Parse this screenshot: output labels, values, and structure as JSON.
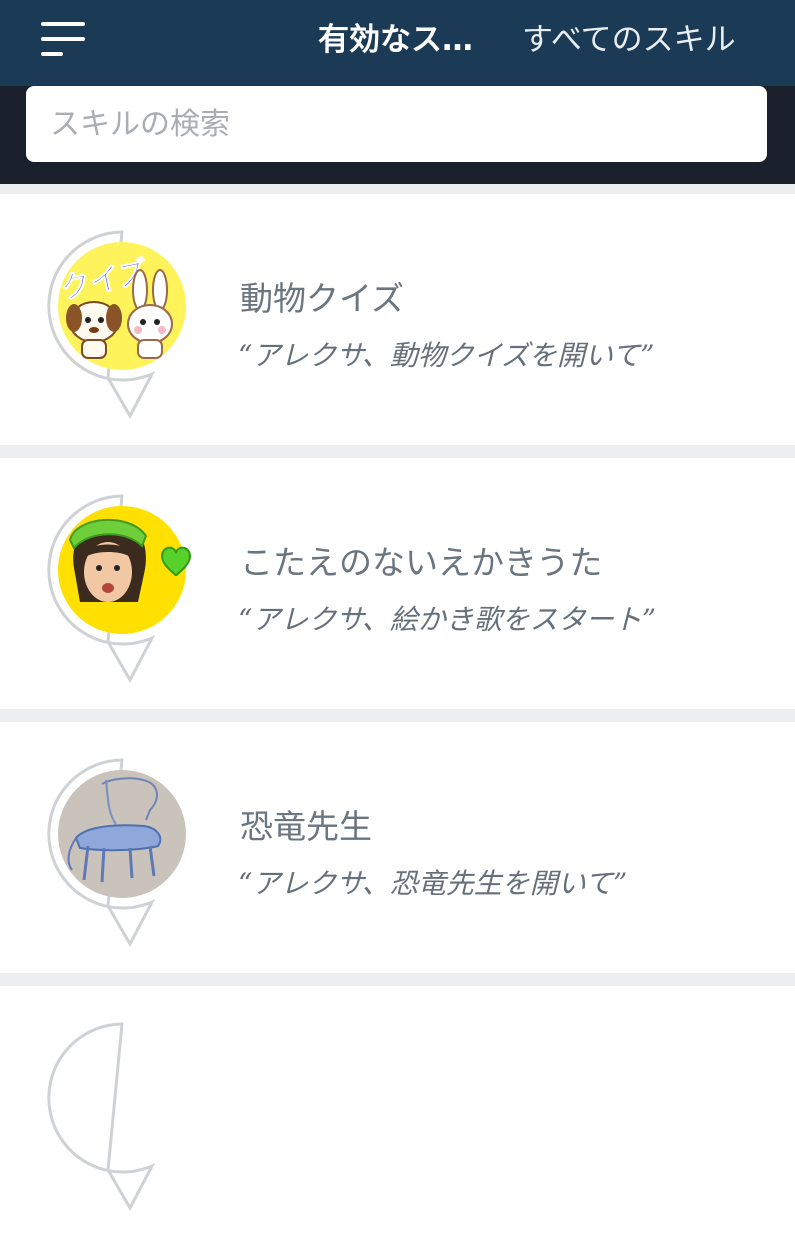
{
  "header": {
    "menu_icon": "hamburger-menu-icon",
    "tabs": [
      {
        "label": "有効なス…",
        "active": true
      },
      {
        "label": "すべてのスキル",
        "active": false
      }
    ],
    "bg_color": "#1b3a55"
  },
  "search": {
    "placeholder": "スキルの検索",
    "value": ""
  },
  "skills": [
    {
      "name": "動物クイズ",
      "phrase": "“アレクサ、動物クイズを開いて”",
      "icon": "animal-quiz-icon",
      "icon_text": "クイズ"
    },
    {
      "name": "こたえのないえかきうた",
      "phrase": "“アレクサ、絵かき歌をスタート”",
      "icon": "girl-with-heart-icon"
    },
    {
      "name": "恐竜先生",
      "phrase": "“アレクサ、恐竜先生を開いて”",
      "icon": "dinosaur-drawing-icon"
    }
  ]
}
